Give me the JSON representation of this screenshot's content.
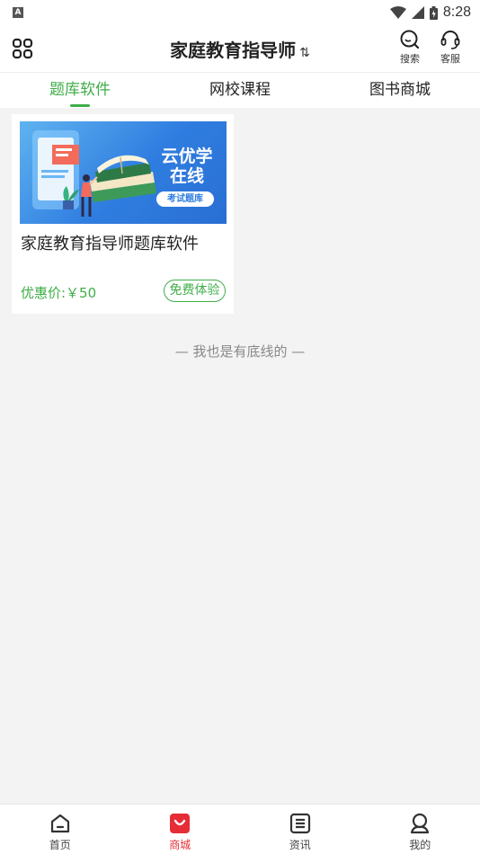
{
  "status_bar": {
    "left_badge": "A",
    "time": "8:28",
    "icons": [
      "wifi-icon",
      "signal-icon",
      "battery-icon"
    ]
  },
  "header": {
    "title": "家庭教育指导师",
    "switch_icon": "⇅",
    "menu_icon": "grid-menu-icon",
    "search_label": "搜索",
    "service_label": "客服"
  },
  "tabs": [
    {
      "label": "题库软件",
      "active": true
    },
    {
      "label": "网校课程",
      "active": false
    },
    {
      "label": "图书商城",
      "active": false
    }
  ],
  "product": {
    "image_brand_line1": "云优学",
    "image_brand_line2": "在线",
    "image_tag": "考试题库",
    "title": "家庭教育指导师题库软件",
    "price": "优惠价:￥50",
    "action_label": "免费体验"
  },
  "end_note": "— 我也是有底线的 —",
  "bottom_nav": [
    {
      "label": "首页",
      "icon": "home-icon",
      "active": false
    },
    {
      "label": "商城",
      "icon": "shop-bag-icon",
      "active": true
    },
    {
      "label": "资讯",
      "icon": "news-icon",
      "active": false
    },
    {
      "label": "我的",
      "icon": "profile-icon",
      "active": false
    }
  ],
  "colors": {
    "accent_green": "#3fae48",
    "accent_red": "#e62c35",
    "background": "#f3f3f3"
  }
}
